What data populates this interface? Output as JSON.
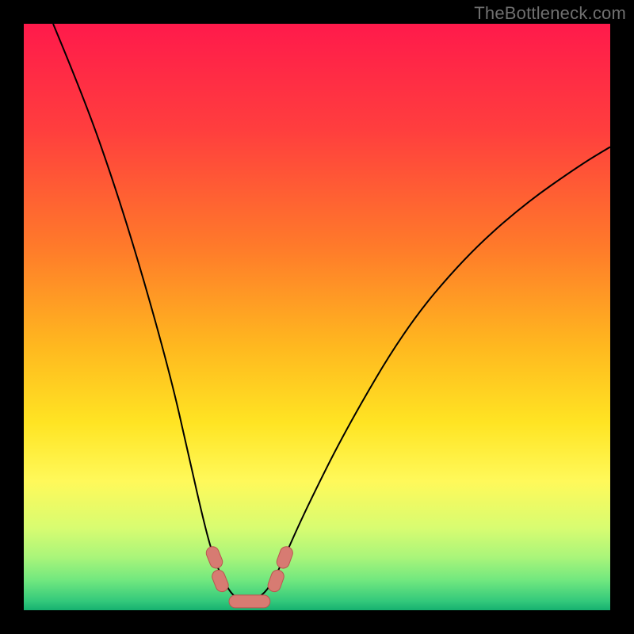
{
  "attribution": "TheBottleneck.com",
  "colors": {
    "frame": "#000000",
    "gradient_stops": [
      {
        "offset": 0.0,
        "color": "#ff1a4b"
      },
      {
        "offset": 0.18,
        "color": "#ff3e3e"
      },
      {
        "offset": 0.38,
        "color": "#ff7a2a"
      },
      {
        "offset": 0.55,
        "color": "#ffb81f"
      },
      {
        "offset": 0.68,
        "color": "#ffe423"
      },
      {
        "offset": 0.78,
        "color": "#fff95a"
      },
      {
        "offset": 0.86,
        "color": "#d8fc71"
      },
      {
        "offset": 0.91,
        "color": "#a9f57a"
      },
      {
        "offset": 0.95,
        "color": "#6fe77f"
      },
      {
        "offset": 0.985,
        "color": "#32c87b"
      },
      {
        "offset": 1.0,
        "color": "#16b06f"
      }
    ],
    "curve": "#000000",
    "marker_fill": "#d77b72",
    "marker_stroke": "#b9564f"
  },
  "chart_data": {
    "type": "line",
    "title": "",
    "xlabel": "",
    "ylabel": "",
    "xlim": [
      0,
      100
    ],
    "ylim": [
      0,
      100
    ],
    "series": [
      {
        "name": "bottleneck-curve",
        "x": [
          5,
          10,
          15,
          20,
          25,
          28,
          30,
          32,
          34,
          36,
          38,
          40,
          42,
          44,
          48,
          55,
          65,
          75,
          85,
          95,
          100
        ],
        "y": [
          100,
          88,
          74,
          58,
          40,
          27,
          18,
          10,
          5,
          2,
          2,
          2,
          4,
          8,
          17,
          31,
          48,
          60,
          69,
          76,
          79
        ]
      }
    ],
    "markers": [
      {
        "name": "left-marker-upper",
        "x": 32.5,
        "y": 9
      },
      {
        "name": "left-marker-lower",
        "x": 33.5,
        "y": 5
      },
      {
        "name": "floor-segment",
        "x_from": 35,
        "x_to": 42,
        "y": 1.5
      },
      {
        "name": "right-marker-lower",
        "x": 43.0,
        "y": 5
      },
      {
        "name": "right-marker-upper",
        "x": 44.5,
        "y": 9
      }
    ]
  }
}
